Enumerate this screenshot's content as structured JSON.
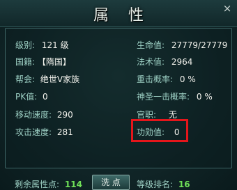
{
  "window": {
    "title": "属性",
    "close_symbol": "×"
  },
  "left": [
    {
      "label": "级别:",
      "value": "121 级"
    },
    {
      "label": "国籍:",
      "value": "【隋国】"
    },
    {
      "label": "帮会:",
      "value": "绝世V家族"
    },
    {
      "label": "PK值:",
      "value": "0"
    },
    {
      "label": "移动速度:",
      "value": "290"
    },
    {
      "label": "攻击速度:",
      "value": "281"
    }
  ],
  "right": [
    {
      "label": "生命值:",
      "value": "27779/27779"
    },
    {
      "label": "法术值:",
      "value": "2964"
    },
    {
      "label": "重击概率:",
      "value": "0 %"
    },
    {
      "label": "神圣一击概率:",
      "value": "0 %"
    },
    {
      "label": "官职:",
      "value": "无"
    },
    {
      "label": "功勋值:",
      "value": "0"
    }
  ],
  "bottom": {
    "remaining_label": "剩余属性点:",
    "remaining_value": "114",
    "wash_button": "洗 点",
    "rank_label": "等级排名:",
    "rank_value": "16"
  },
  "colors": {
    "highlight_box": "#e4161b",
    "label": "#9dd0c4",
    "value": "#f2f2ec",
    "number": "#6fe058"
  }
}
